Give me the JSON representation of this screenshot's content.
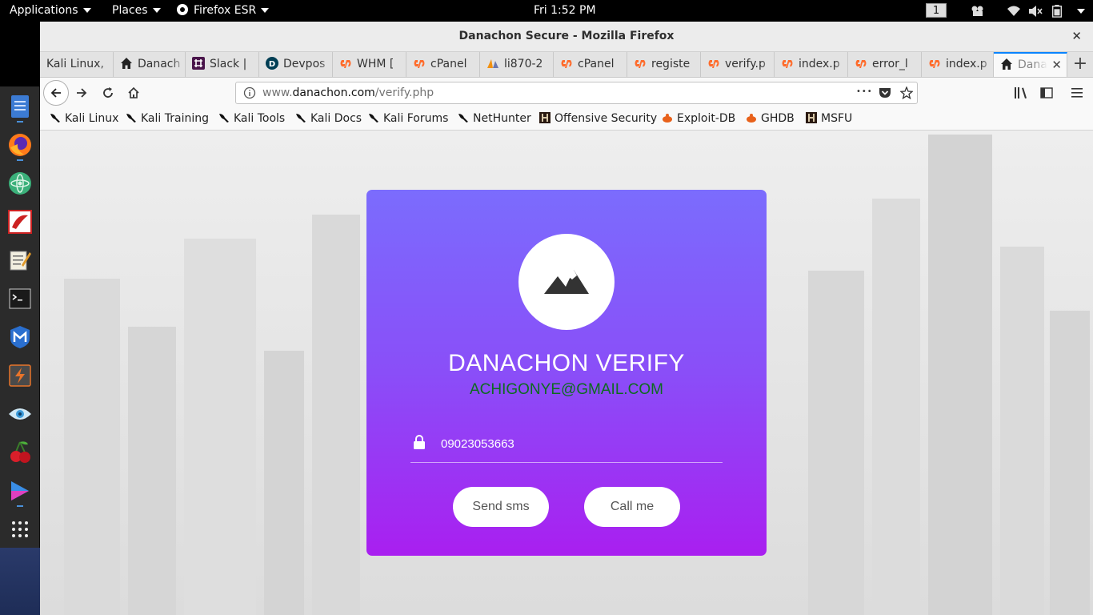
{
  "topbar": {
    "applications": "Applications",
    "places": "Places",
    "app_name": "Firefox ESR",
    "clock": "Fri  1:52 PM",
    "workspace": "1"
  },
  "dock": {
    "items": [
      "file-manager-icon",
      "firefox-icon",
      "atom-icon",
      "app-red-icon",
      "text-editor-icon",
      "terminal-icon",
      "metasploit-icon",
      "burpsuite-icon",
      "eye-icon",
      "cherrytree-icon",
      "media-player-icon",
      "show-apps-icon"
    ]
  },
  "window": {
    "title": "Danachon Secure - Mozilla Firefox",
    "close_glyph": "✕"
  },
  "tabs": [
    {
      "label": "Kali Linux, ",
      "icon": "none"
    },
    {
      "label": "Danach",
      "icon": "home"
    },
    {
      "label": "Slack | ",
      "icon": "slack"
    },
    {
      "label": "Devpos",
      "icon": "devpost"
    },
    {
      "label": "WHM [",
      "icon": "cpanel"
    },
    {
      "label": "cPanel ",
      "icon": "cpanel"
    },
    {
      "label": "li870-2",
      "icon": "pma"
    },
    {
      "label": "cPanel ",
      "icon": "cpanel"
    },
    {
      "label": "registe",
      "icon": "cpanel"
    },
    {
      "label": "verify.p",
      "icon": "cpanel"
    },
    {
      "label": "index.p",
      "icon": "cpanel"
    },
    {
      "label": "error_l",
      "icon": "cpanel"
    },
    {
      "label": "index.p",
      "icon": "cpanel"
    },
    {
      "label": "Dana",
      "icon": "home"
    }
  ],
  "tab_close_glyph": "✕",
  "new_tab_glyph": "+",
  "url": {
    "prefix": "www.",
    "host": "danachon.com",
    "path": "/verify.php",
    "more_glyph": "•••"
  },
  "bookmarks": [
    {
      "label": "Kali Linux",
      "icon": "kali"
    },
    {
      "label": "Kali Training",
      "icon": "kali"
    },
    {
      "label": "Kali Tools",
      "icon": "kali"
    },
    {
      "label": "Kali Docs",
      "icon": "kali"
    },
    {
      "label": "Kali Forums",
      "icon": "kali"
    },
    {
      "label": "NetHunter",
      "icon": "kali"
    },
    {
      "label": "Offensive Security",
      "icon": "offsec"
    },
    {
      "label": "Exploit-DB",
      "icon": "exploitdb"
    },
    {
      "label": "GHDB",
      "icon": "exploitdb"
    },
    {
      "label": "MSFU",
      "icon": "offsec"
    }
  ],
  "card": {
    "title": "DANACHON VERIFY",
    "email": "ACHIGONYE@GMAIL.COM",
    "code_value": "09023053663",
    "send_sms": "Send sms",
    "call_me": "Call me"
  },
  "colors": {
    "card_top": "#7b6cfd",
    "card_bottom": "#a91ff0",
    "email": "#0d6b1f",
    "tab_accent": "#0a84ff"
  }
}
